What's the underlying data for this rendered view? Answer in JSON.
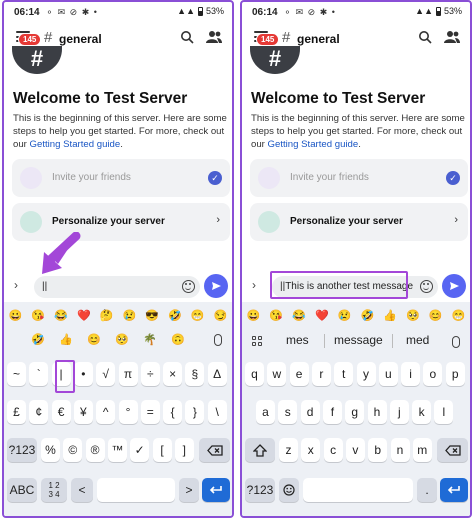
{
  "status": {
    "time": "06:14",
    "battery": "53%"
  },
  "app": {
    "badge": "145",
    "channel": "general"
  },
  "welcome": {
    "title": "Welcome to Test Server",
    "text": "This is the beginning of this server. Here are some steps to help you get started. For more, check out our",
    "link": "Getting Started guide",
    "link_suffix": "."
  },
  "cards": {
    "invite": "Invite your friends",
    "personalize": "Personalize your server"
  },
  "left": {
    "message": "||"
  },
  "right": {
    "message": "||This is another test message"
  },
  "emoji_strip": {
    "left": [
      "😀",
      "😘",
      "😂",
      "❤️",
      "🤔",
      "😢",
      "😎",
      "🤣",
      "😁",
      "😏"
    ],
    "left2": [
      "🤣",
      "👍",
      "😊",
      "🥺",
      "🌴",
      "🙃"
    ],
    "right": [
      "😀",
      "😘",
      "😂",
      "❤️",
      "😢",
      "🤣",
      "👍",
      "🥺",
      "😊",
      "😁"
    ]
  },
  "suggestions": [
    "mes",
    "message",
    "med"
  ],
  "keys": {
    "sym_row1": [
      "~",
      "`",
      "|",
      "•",
      "√",
      "π",
      "÷",
      "×",
      "§",
      "Δ"
    ],
    "sym_row2": [
      "£",
      "¢",
      "€",
      "¥",
      "^",
      "°",
      "=",
      "{",
      "}",
      "\\"
    ],
    "sym_row3": [
      "%",
      "©",
      "®",
      "™",
      "✓",
      "[",
      "]"
    ],
    "sym_mode": "?123",
    "abc_mode": "ABC",
    "pages": "1 2\n3 4",
    "alpha_row1": [
      "q",
      "w",
      "e",
      "r",
      "t",
      "y",
      "u",
      "i",
      "o",
      "p"
    ],
    "alpha_row2": [
      "a",
      "s",
      "d",
      "f",
      "g",
      "h",
      "j",
      "k",
      "l"
    ],
    "alpha_row3": [
      "z",
      "x",
      "c",
      "v",
      "b",
      "n",
      "m"
    ],
    "comma": ",",
    "period": ".",
    "less": "<",
    "greater": ">"
  },
  "colors": {
    "accent": "#5865f2",
    "highlight": "#a347d8",
    "enter": "#1f6bd6"
  }
}
